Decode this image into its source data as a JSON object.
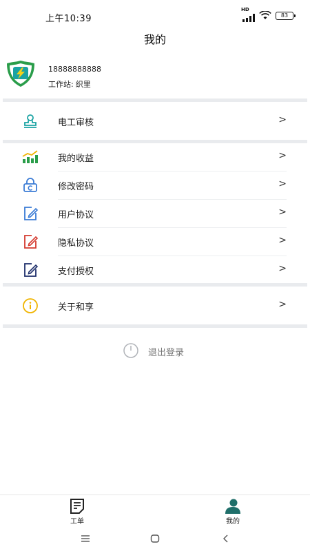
{
  "status_bar": {
    "time": "上午10:39",
    "network": "HD",
    "battery": "83"
  },
  "header": {
    "title": "我的"
  },
  "profile": {
    "phone": "18888888888",
    "station_label": "工作站:",
    "station_name": "织里"
  },
  "menu": {
    "group1": [
      {
        "label": "电工审核",
        "icon": "stamp-icon",
        "arrow": ">"
      }
    ],
    "group2": [
      {
        "label": "我的收益",
        "icon": "earnings-chart-icon",
        "arrow": ">"
      },
      {
        "label": "修改密码",
        "icon": "lock-icon",
        "arrow": ">"
      },
      {
        "label": "用户协议",
        "icon": "edit-document-icon",
        "arrow": ">"
      },
      {
        "label": "隐私协议",
        "icon": "edit-document-icon",
        "arrow": ">"
      },
      {
        "label": "支付授权",
        "icon": "edit-document-icon",
        "arrow": ">"
      }
    ],
    "group3": [
      {
        "label": "关于和享",
        "icon": "info-icon",
        "arrow": ">"
      }
    ]
  },
  "logout": {
    "label": "退出登录"
  },
  "tabbar": {
    "tabs": [
      {
        "label": "工单",
        "icon": "work-order-icon"
      },
      {
        "label": "我的",
        "icon": "user-icon",
        "active": true
      }
    ]
  },
  "colors": {
    "teal": "#1aa3a3",
    "green": "#2a9d4a",
    "blue": "#3a7bd5",
    "red": "#d43a2f",
    "navy": "#1e2f6b",
    "yellow": "#f0b400",
    "divider": "#e9ebee"
  }
}
